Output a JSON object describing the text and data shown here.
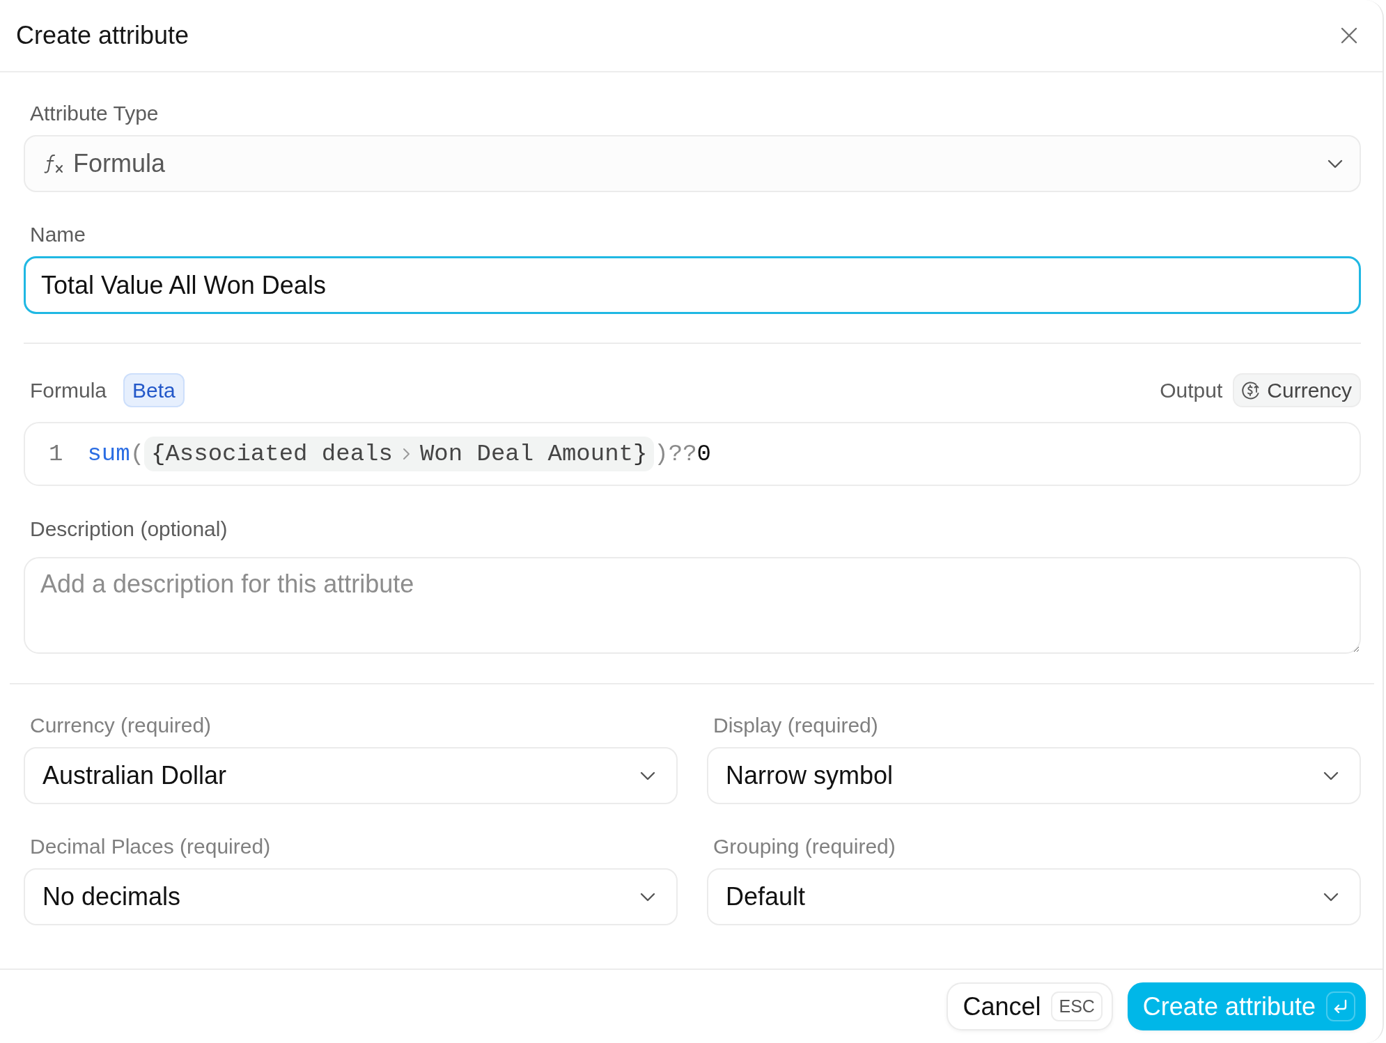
{
  "dialog": {
    "title": "Create attribute"
  },
  "attribute_type": {
    "label": "Attribute Type",
    "value": "Formula",
    "disabled": true
  },
  "name": {
    "label": "Name",
    "value": "Total Value All Won Deals",
    "focused": true
  },
  "formula": {
    "label": "Formula",
    "badge": "Beta",
    "output_label": "Output",
    "output_type": "Currency",
    "line_number": "1",
    "tokens": [
      {
        "kind": "function",
        "text": "sum"
      },
      {
        "kind": "punctuation",
        "text": "("
      },
      {
        "kind": "reference",
        "open": "{",
        "path": [
          "Associated deals",
          "Won Deal Amount"
        ],
        "close": "}"
      },
      {
        "kind": "punctuation",
        "text": ")"
      },
      {
        "kind": "operator",
        "text": "??"
      },
      {
        "kind": "number",
        "text": "0"
      }
    ]
  },
  "description": {
    "label": "Description (optional)",
    "placeholder": "Add a description for this attribute"
  },
  "settings": [
    {
      "label": "Currency (required)",
      "value": "Australian Dollar"
    },
    {
      "label": "Display (required)",
      "value": "Narrow symbol"
    },
    {
      "label": "Decimal Places (required)",
      "value": "No decimals"
    },
    {
      "label": "Grouping (required)",
      "value": "Default"
    }
  ],
  "footer": {
    "buttons": [
      {
        "kind": "secondary",
        "label": "Cancel",
        "shortcut": "ESC"
      },
      {
        "kind": "primary",
        "label": "Create attribute"
      }
    ]
  }
}
